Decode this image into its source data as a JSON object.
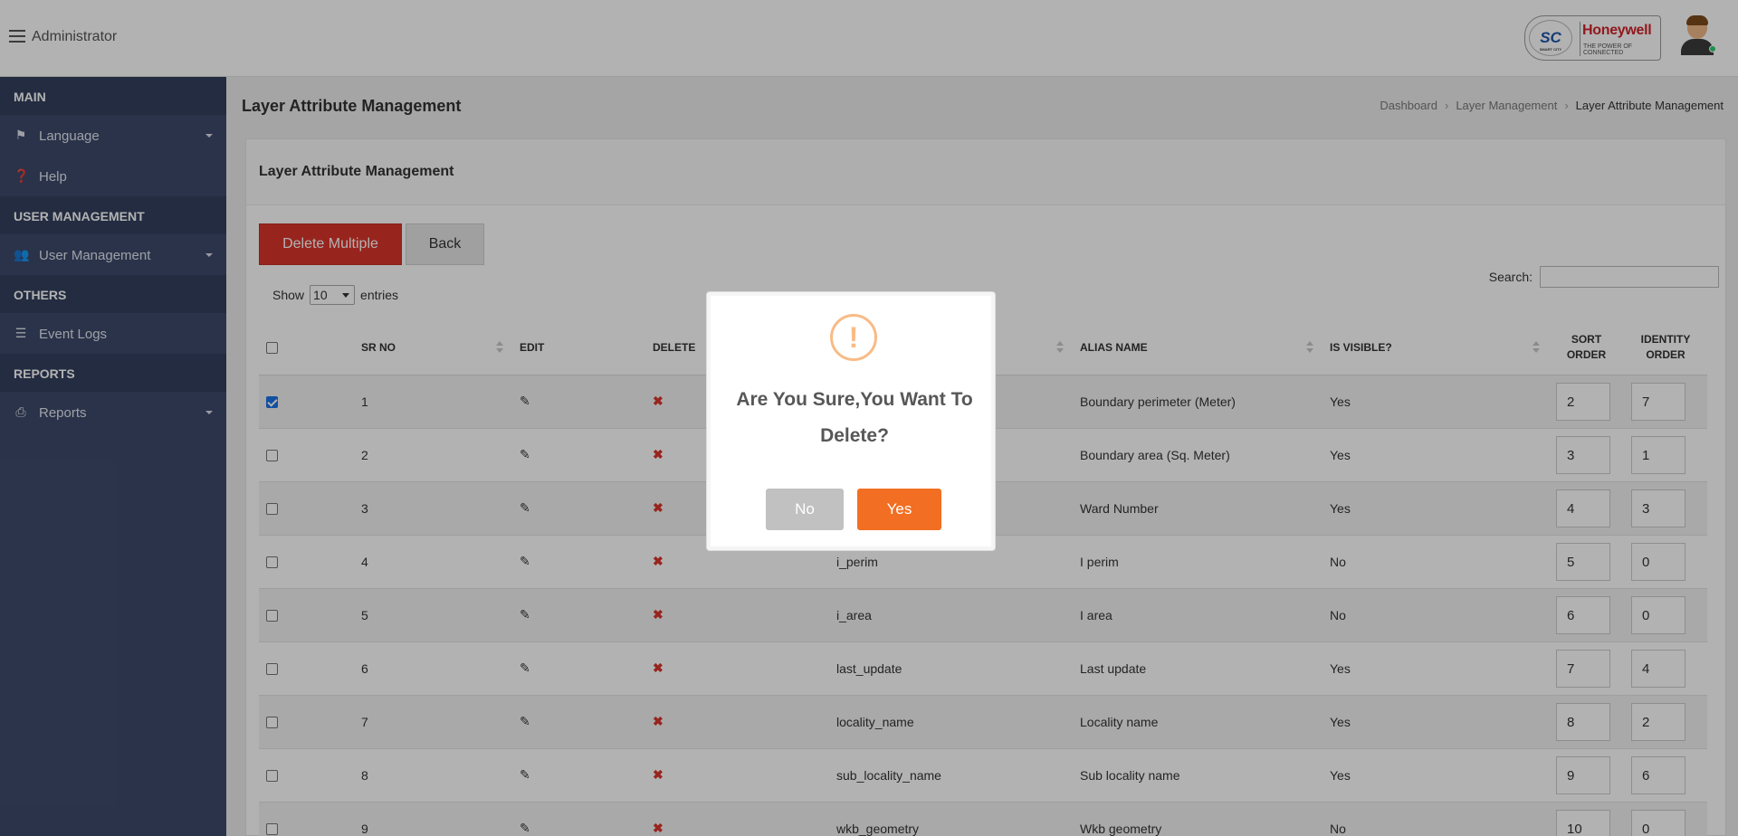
{
  "header": {
    "user_name": "Administrator",
    "logo_brand": "Honeywell",
    "logo_tagline": "THE POWER OF CONNECTED",
    "logo_emblem": "SC",
    "logo_emblem_small": "SMART CITY"
  },
  "sidebar": {
    "sections": [
      {
        "title": "MAIN",
        "items": [
          {
            "label": "Language",
            "icon": "flag-icon",
            "has_caret": true
          },
          {
            "label": "Help",
            "icon": "question-circle-icon",
            "has_caret": false
          }
        ]
      },
      {
        "title": "USER MANAGEMENT",
        "items": [
          {
            "label": "User Management",
            "icon": "users-icon",
            "has_caret": true
          }
        ]
      },
      {
        "title": "OTHERS",
        "items": [
          {
            "label": "Event Logs",
            "icon": "list-icon",
            "has_caret": false
          }
        ]
      },
      {
        "title": "REPORTS",
        "items": [
          {
            "label": "Reports",
            "icon": "print-icon",
            "has_caret": true
          }
        ]
      }
    ]
  },
  "page": {
    "title": "Layer Attribute Management",
    "breadcrumb": [
      "Dashboard",
      "Layer Management",
      "Layer Attribute Management"
    ]
  },
  "card": {
    "title": "Layer Attribute Management",
    "delete_multiple_label": "Delete Multiple",
    "back_label": "Back",
    "show_label": "Show",
    "entries_value": "10",
    "entries_label": "entries",
    "search_label": "Search:",
    "search_value": ""
  },
  "table": {
    "columns": {
      "sr_no": "SR NO",
      "edit": "EDIT",
      "delete": "DELETE",
      "alias_name": "ALIAS NAME",
      "is_visible": "IS VISIBLE?",
      "sort_order": [
        "SORT",
        "ORDER"
      ],
      "identity_order": [
        "IDENTITY",
        "ORDER"
      ]
    },
    "rows": [
      {
        "checked": true,
        "sr": "1",
        "attribute": "",
        "alias": "Boundary perimeter (Meter)",
        "visible": "Yes",
        "sort": "2",
        "identity": "7"
      },
      {
        "checked": false,
        "sr": "2",
        "attribute": "",
        "alias": "Boundary area (Sq. Meter)",
        "visible": "Yes",
        "sort": "3",
        "identity": "1"
      },
      {
        "checked": false,
        "sr": "3",
        "attribute": "",
        "alias": "Ward Number",
        "visible": "Yes",
        "sort": "4",
        "identity": "3"
      },
      {
        "checked": false,
        "sr": "4",
        "attribute": "i_perim",
        "alias": "I perim",
        "visible": "No",
        "sort": "5",
        "identity": "0"
      },
      {
        "checked": false,
        "sr": "5",
        "attribute": "i_area",
        "alias": "I area",
        "visible": "No",
        "sort": "6",
        "identity": "0"
      },
      {
        "checked": false,
        "sr": "6",
        "attribute": "last_update",
        "alias": "Last update",
        "visible": "Yes",
        "sort": "7",
        "identity": "4"
      },
      {
        "checked": false,
        "sr": "7",
        "attribute": "locality_name",
        "alias": "Locality name",
        "visible": "Yes",
        "sort": "8",
        "identity": "2"
      },
      {
        "checked": false,
        "sr": "8",
        "attribute": "sub_locality_name",
        "alias": "Sub locality name",
        "visible": "Yes",
        "sort": "9",
        "identity": "6"
      },
      {
        "checked": false,
        "sr": "9",
        "attribute": "wkb_geometry",
        "alias": "Wkb geometry",
        "visible": "No",
        "sort": "10",
        "identity": "0"
      }
    ]
  },
  "modal": {
    "icon_glyph": "!",
    "message": "Are You Sure,You Want To Delete?",
    "no_label": "No",
    "yes_label": "Yes",
    "yes_color": "#f26e22",
    "no_color": "#c1c1c1"
  }
}
